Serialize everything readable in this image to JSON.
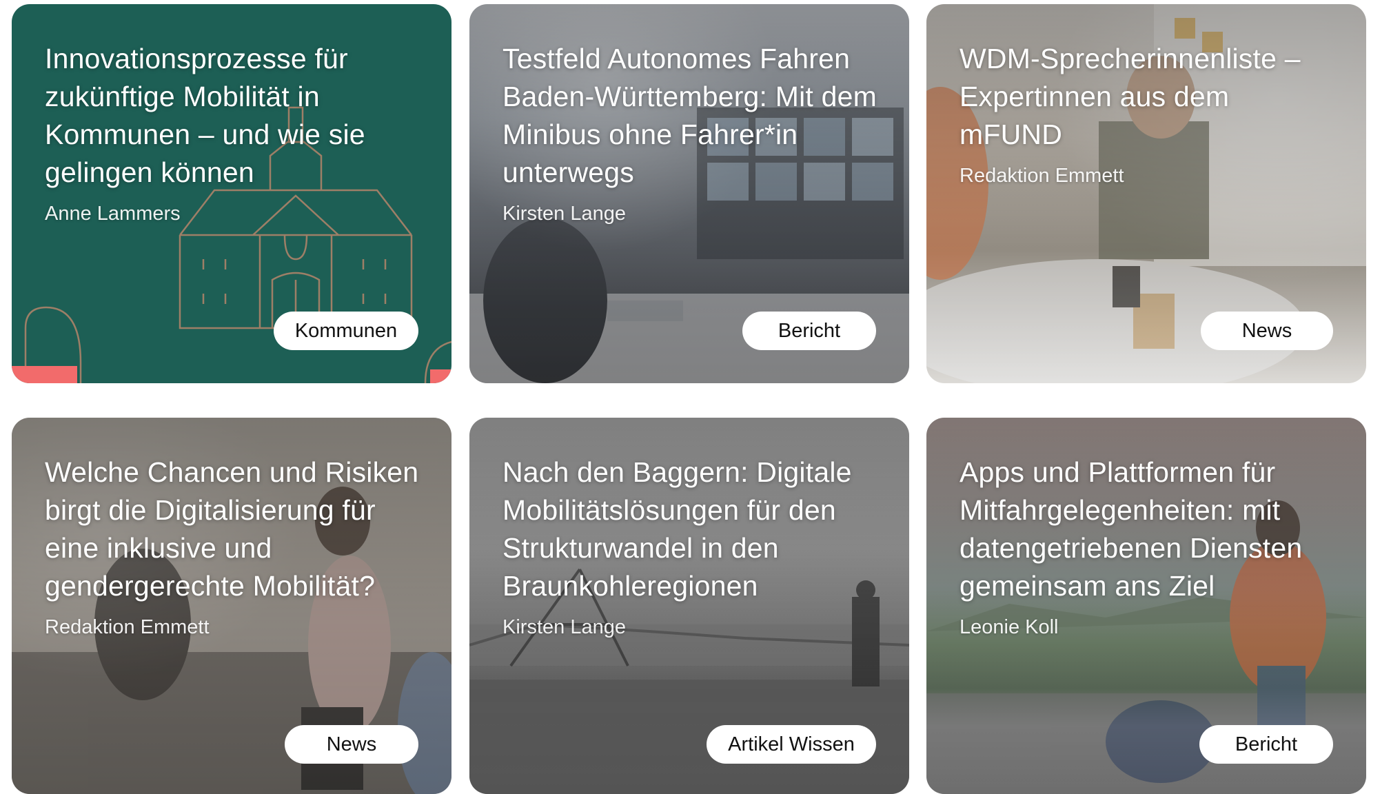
{
  "cards": [
    {
      "title": "Innovationsprozesse für zukünftige Mobilität in Kommunen – und wie sie gelingen können",
      "author": "Anne Lammers",
      "tag": "Kommunen"
    },
    {
      "title": "Testfeld Autonomes Fahren Baden-Württemberg: Mit dem Minibus ohne Fahrer*in unterwegs",
      "author": "Kirsten Lange",
      "tag": "Bericht"
    },
    {
      "title": "WDM-Sprecherinnenliste – Expertinnen aus dem mFUND",
      "author": "Redaktion Emmett",
      "tag": "News"
    },
    {
      "title": "Welche Chancen und Risiken birgt die Digitalisierung für eine inklusive und gendergerechte Mobilität?",
      "author": "Redaktion Emmett",
      "tag": "News"
    },
    {
      "title": "Nach den Baggern: Digitale Mobilitätslösungen für den Strukturwandel in den Braunkohleregionen",
      "author": "Kirsten Lange",
      "tag": "Artikel Wissen"
    },
    {
      "title": "Apps und Plattformen für Mitfahrgelegenheiten: mit datengetriebenen Diensten gemeinsam ans Ziel",
      "author": "Leonie Koll",
      "tag": "Bericht"
    }
  ],
  "colors": {
    "teal_card": "#1d5f55",
    "accent_coral": "#f26b6b",
    "line_art": "#c98a6d",
    "tag_bg": "#ffffff",
    "tag_text": "#111111"
  }
}
